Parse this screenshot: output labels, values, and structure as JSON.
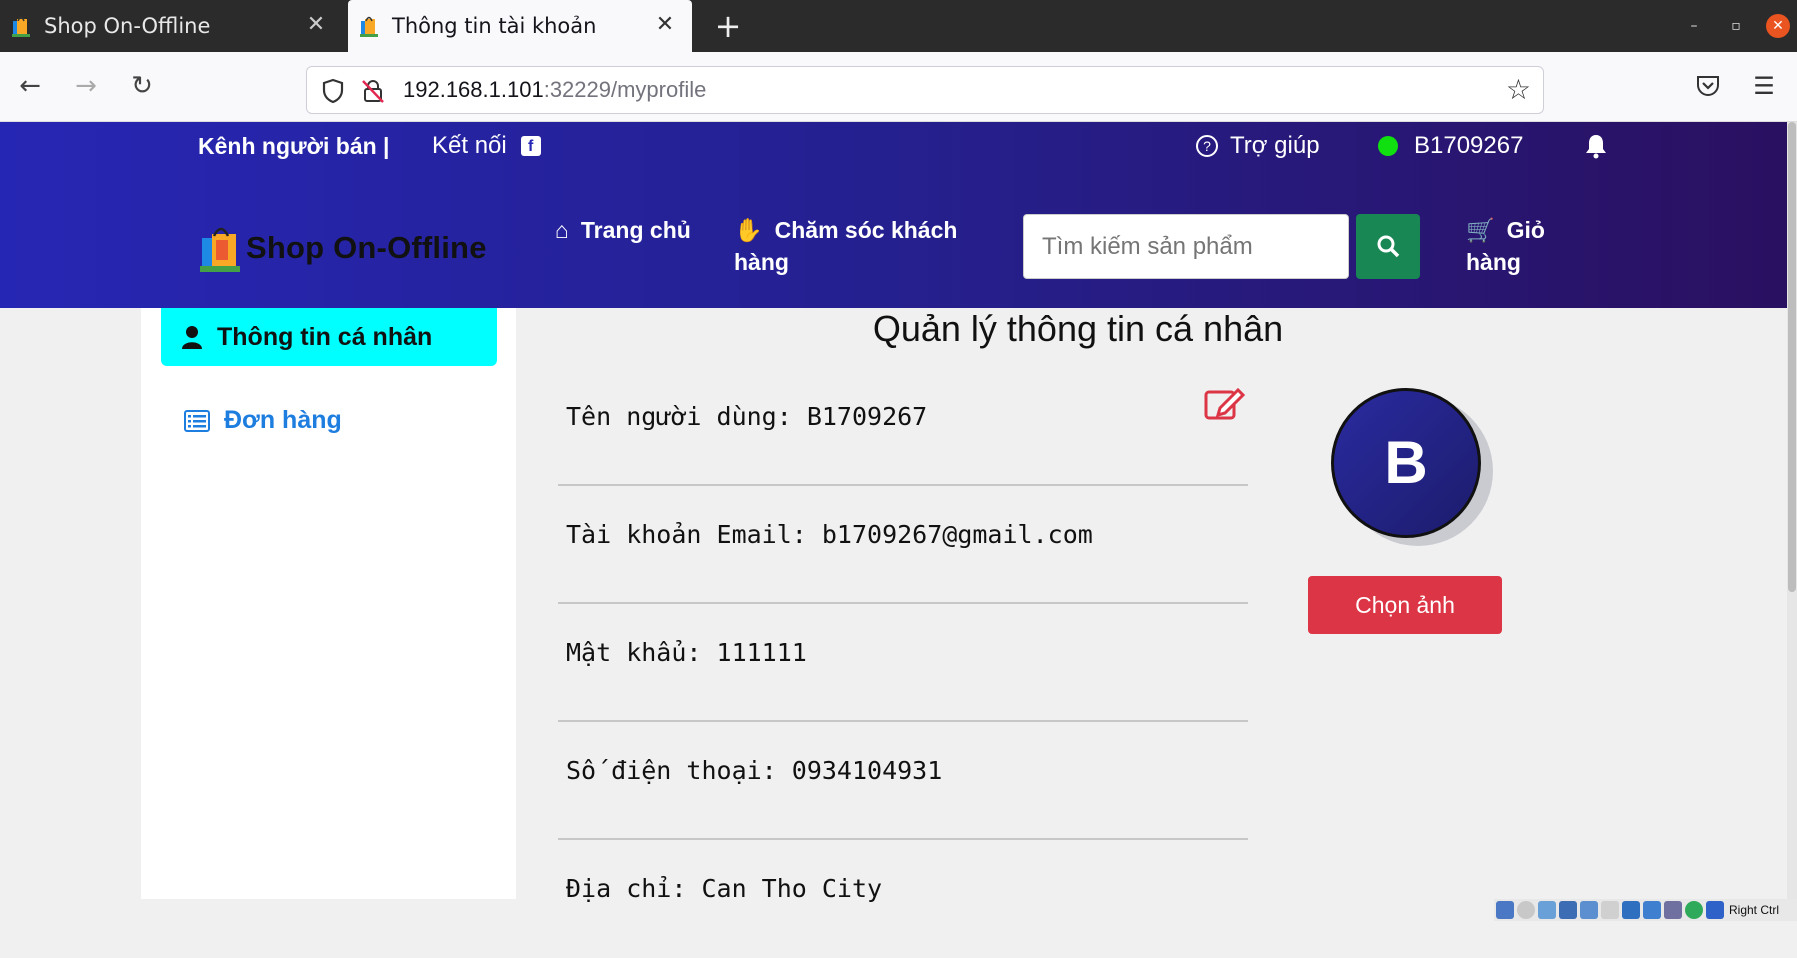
{
  "browser": {
    "tabs": [
      {
        "title": "Shop On-Offline",
        "active": false
      },
      {
        "title": "Thông tin tài khoản",
        "active": true
      }
    ],
    "url_host": "192.168.1.101",
    "url_rest": ":32229/myprofile"
  },
  "header": {
    "seller_channel": "Kênh người bán |",
    "connect": "Kết nối",
    "help": "Trợ giúp",
    "username": "B1709267",
    "brand": "Shop On-Offline",
    "nav": {
      "home": "Trang chủ",
      "customer_care": "Chăm sóc khách hàng",
      "cart": "Giỏ hàng"
    },
    "search_placeholder": "Tìm kiếm sản phẩm"
  },
  "sidebar": {
    "items": [
      {
        "label": "Thông tin cá nhân",
        "active": true
      },
      {
        "label": "Đơn hàng",
        "active": false
      }
    ]
  },
  "profile": {
    "title": "Quản lý thông tin cá nhân",
    "fields": [
      "Tên người dùng: B1709267",
      "Tài khoản Email: b1709267@gmail.com",
      "Mật khẩu: 111111",
      "Số điện thoại: 0934104931",
      "Địa chỉ: Can Tho City"
    ],
    "avatar_letter": "B",
    "choose_image": "Chọn ảnh"
  },
  "statusbar": {
    "host_key": "Right Ctrl"
  },
  "colors": {
    "header_gradient_start": "#2626b4",
    "header_gradient_end": "#2a1060",
    "active_menu": "#00ffff",
    "search_button": "#198754",
    "choose_image_button": "#dc3545",
    "online_dot": "#10e010"
  }
}
